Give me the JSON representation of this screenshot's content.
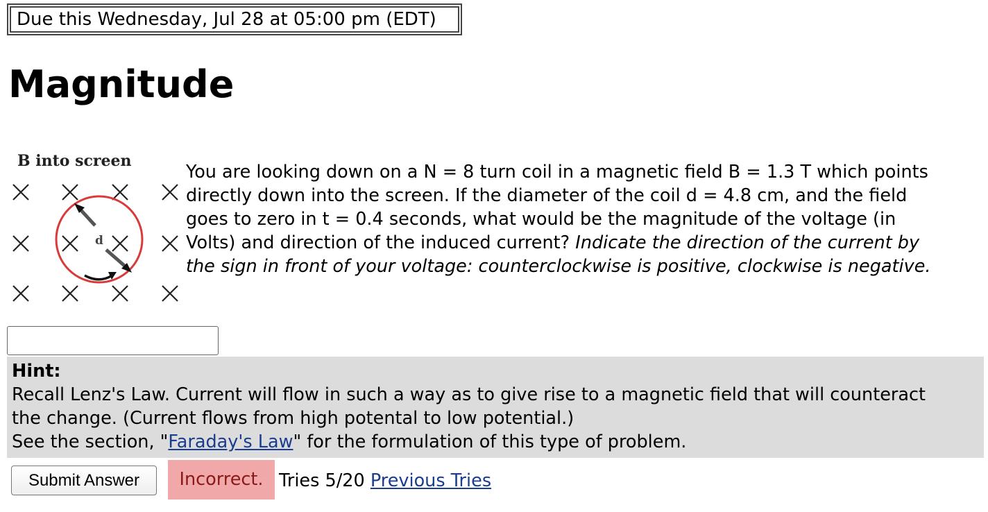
{
  "due": {
    "text": "Due this Wednesday, Jul 28 at 05:00 pm (EDT)"
  },
  "problem": {
    "title": "Magnitude",
    "figure": {
      "label": "B into screen",
      "diameter_label": "d",
      "mark_glyph": "×",
      "icons": [
        "field-into-screen-x-marks",
        "coil-circle",
        "diameter-arrow",
        "current-direction-arrow"
      ]
    },
    "question_plain": "You are looking down on a N = 8 turn coil in a magnetic field B = 1.3 T which points directly down into the screen. If the diameter of the coil d = 4.8 cm, and the field goes to zero in t = 0.4 seconds, what would be the magnitude of the voltage (in Volts) and direction of the induced current?",
    "question_lines": [
      "You are looking down on a N = 8 turn coil in a magnetic field B = 1.3 T which points",
      "directly down into the screen. If the diameter of the coil d = 4.8 cm, and the field",
      "goes to zero in t = 0.4 seconds, what would be the magnitude of the voltage (in",
      "Volts) and direction of the induced current? "
    ],
    "question_emphasis_lines": [
      "Indicate the direction of the current by",
      "the sign in front of your voltage: counterclockwise is positive, clockwise is negative."
    ]
  },
  "answer": {
    "value": "",
    "placeholder": ""
  },
  "hint": {
    "title": "Hint:",
    "line1": "Recall Lenz's Law. Current will flow in such a way as to give rise to a magnetic field that will counteract",
    "line2": "the change. (Current flows from high potental to low potential.)",
    "line3_prefix": "See the section, \"",
    "link_text": "Faraday's Law",
    "line3_suffix": "\" for the formulation of this type of problem."
  },
  "submit": {
    "label": "Submit Answer"
  },
  "status": {
    "text": "Incorrect.",
    "bg_color": "#f0a8a8",
    "text_color": "#8a1a1a"
  },
  "tries": {
    "text": "Tries 5/20",
    "previous_label": "Previous Tries"
  },
  "colors": {
    "coil": "#d93a3a",
    "link": "#1a3d8f",
    "hint_bg": "#dcdcdc"
  }
}
